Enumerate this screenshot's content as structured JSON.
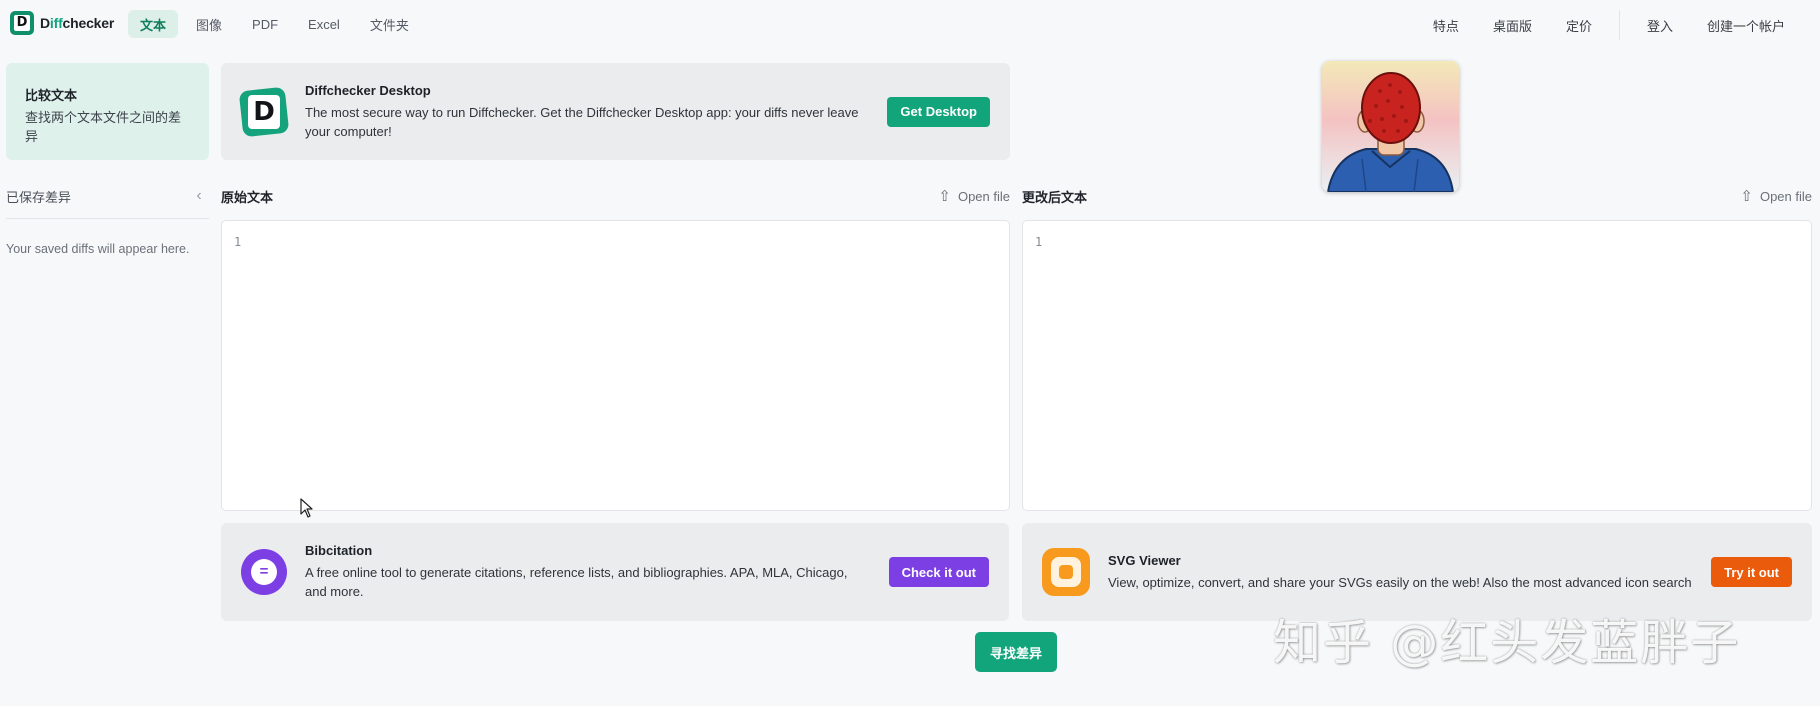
{
  "brand": {
    "name_prefix": "D",
    "name_accent": "iff",
    "name_rest": "checker"
  },
  "nav": {
    "tabs": [
      {
        "label": "文本",
        "active": true
      },
      {
        "label": "图像",
        "active": false
      },
      {
        "label": "PDF",
        "active": false
      },
      {
        "label": "Excel",
        "active": false
      },
      {
        "label": "文件夹",
        "active": false
      }
    ],
    "right": [
      "特点",
      "桌面版",
      "定价"
    ],
    "login": "登入",
    "signup": "创建一个帐户"
  },
  "sidebar": {
    "compare_title": "比较文本",
    "compare_desc": "查找两个文本文件之间的差异",
    "saved_title": "已保存差异",
    "saved_empty": "Your saved diffs will appear here."
  },
  "promos": {
    "desktop": {
      "title": "Diffchecker Desktop",
      "desc": "The most secure way to run Diffchecker. Get the Diffchecker Desktop app: your diffs never leave your computer!",
      "button": "Get Desktop",
      "color": "#12a57c"
    },
    "bibcitation": {
      "title": "Bibcitation",
      "desc": "A free online tool to generate citations, reference lists, and bibliographies. APA, MLA, Chicago, and more.",
      "button": "Check it out",
      "color": "#7b3fe4"
    },
    "svgviewer": {
      "title": "SVG Viewer",
      "desc": "View, optimize, convert, and share your SVGs easily on the web! Also the most advanced icon search",
      "button": "Try it out",
      "color": "#ea5b0c"
    }
  },
  "editors": {
    "original": {
      "label": "原始文本",
      "open_file": "Open file",
      "line_number": "1"
    },
    "changed": {
      "label": "更改后文本",
      "open_file": "Open file",
      "line_number": "1"
    }
  },
  "find_diff": "寻找差异",
  "watermark": "知乎 @红头发蓝胖子",
  "icons": {
    "collapse": "chevron-left-icon",
    "upload": "upload-icon"
  }
}
